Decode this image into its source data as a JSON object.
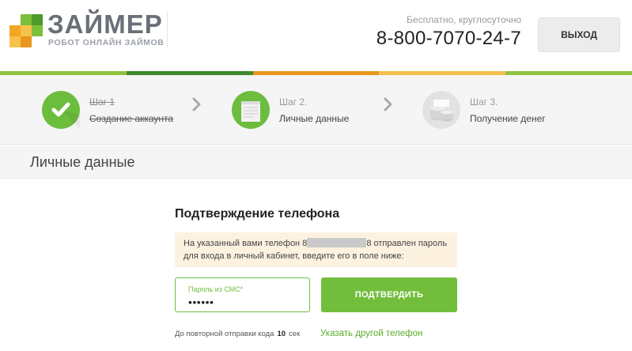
{
  "logo": {
    "title": "ЗАЙМЕР",
    "subtitle": "РОБОТ ОНЛАЙН ЗАЙМОВ"
  },
  "header": {
    "phone_note": "Бесплатно, круглосуточно",
    "phone_number": "8-800-7070-24-7",
    "logout_label": "ВЫХОД"
  },
  "stripe_colors": [
    "#8fc23f",
    "#3f8a2d",
    "#e8961e",
    "#f2c14e",
    "#8fc23f"
  ],
  "steps": [
    {
      "number": "Шаг 1",
      "title": "Создание аккаунта",
      "status": "done",
      "icon": "check-icon",
      "color": "#6cbd3e"
    },
    {
      "number": "Шаг 2.",
      "title": "Личные данные",
      "status": "active",
      "icon": "document-icon",
      "color": "#6cbd3e"
    },
    {
      "number": "Шаг 3.",
      "title": "Получение денег",
      "status": "pending",
      "icon": "coins-icon",
      "color": "#e2e2e2"
    }
  ],
  "section_title": "Личные данные",
  "form": {
    "title": "Подтверждение телефона",
    "notice_before": "На указанный вами телефон 8",
    "notice_after": "8 отправлен пароль для входа в личный кабинет, введите его в поле ниже:",
    "sms_label": "Пароль из СМС*",
    "sms_value": "••••••",
    "confirm_label": "ПОДТВЕРДИТЬ",
    "resend_prefix": "До повторной отправки кода",
    "resend_seconds": "10",
    "resend_suffix": "сек",
    "other_phone_link": "Указать другой телефон"
  }
}
